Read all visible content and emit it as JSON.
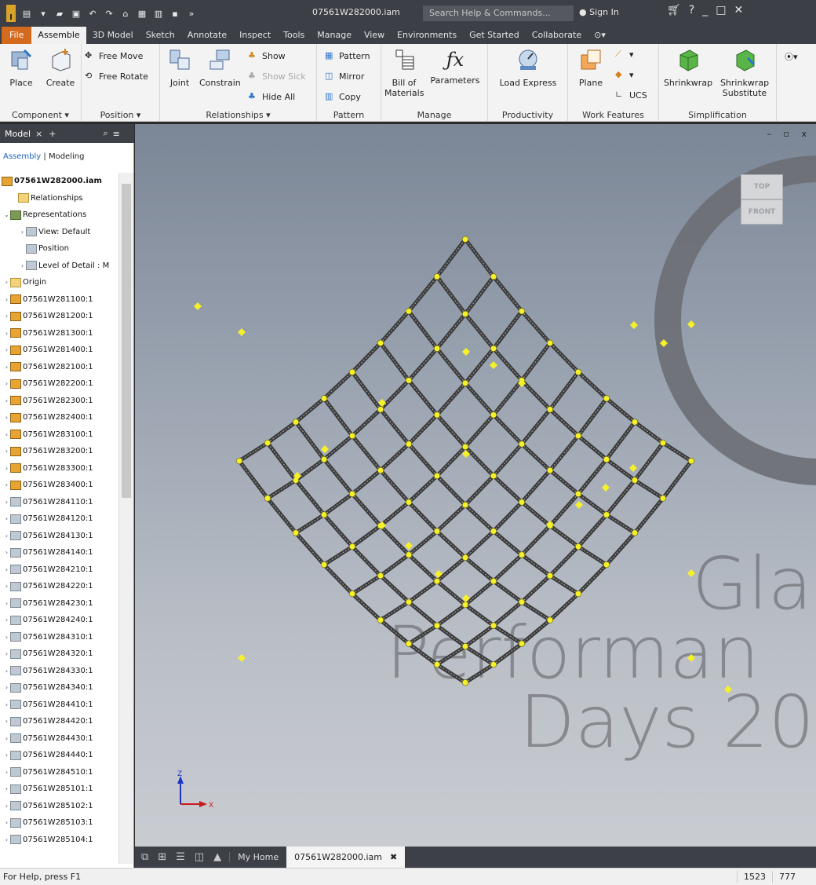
{
  "titlebar": {
    "app_logo": "I",
    "doc_title": "07561W282000.iam",
    "search_placeholder": "Search Help & Commands...",
    "sign_in": "Sign In",
    "qat_icons": [
      "new-icon",
      "open-icon",
      "save-icon",
      "undo-icon",
      "redo-icon",
      "home-icon",
      "appearance-icon",
      "material-icon",
      "measure-icon",
      "more-icon"
    ],
    "controls": [
      "cart-icon",
      "help-icon",
      "minimize-icon",
      "maximize-icon",
      "close-icon"
    ]
  },
  "menu_tabs": [
    "File",
    "Assemble",
    "3D Model",
    "Sketch",
    "Annotate",
    "Inspect",
    "Tools",
    "Manage",
    "View",
    "Environments",
    "Get Started",
    "Collaborate"
  ],
  "menu_active": "Assemble",
  "ribbon": {
    "component": {
      "title": "Component ▾",
      "place": "Place",
      "create": "Create"
    },
    "position": {
      "title": "Position ▾",
      "free_move": "Free Move",
      "free_rotate": "Free Rotate"
    },
    "relationships": {
      "title": "Relationships ▾",
      "joint": "Joint",
      "constrain": "Constrain",
      "show": "Show",
      "show_sick": "Show Sick",
      "hide_all": "Hide All"
    },
    "pattern": {
      "title": "Pattern",
      "pattern": "Pattern",
      "mirror": "Mirror",
      "copy": "Copy"
    },
    "manage": {
      "title": "Manage",
      "bom_line1": "Bill of",
      "bom_line2": "Materials",
      "parameters": "Parameters"
    },
    "productivity": {
      "title": "Productivity",
      "load_express": "Load Express"
    },
    "work_features": {
      "title": "Work Features",
      "plane": "Plane",
      "ucs": "UCS"
    },
    "simplification": {
      "title": "Simplification",
      "shrinkwrap": "Shrinkwrap",
      "shrinkwrap_sub1": "Shrinkwrap",
      "shrinkwrap_sub2": "Substitute"
    }
  },
  "browser": {
    "tab": "Model",
    "tab_close": "×",
    "tab_add": "+",
    "mode_assembly": "Assembly",
    "mode_sep": "|",
    "mode_modeling": "Modeling",
    "root": "07561W282000.iam",
    "nodes": [
      {
        "label": "Relationships",
        "icon": "folder",
        "indent": 1,
        "exp": ""
      },
      {
        "label": "Representations",
        "icon": "rep",
        "indent": 0,
        "exp": "v"
      },
      {
        "label": "View: Default",
        "icon": "part2",
        "indent": 2,
        "exp": ">"
      },
      {
        "label": "Position",
        "icon": "part2",
        "indent": 2,
        "exp": ""
      },
      {
        "label": "Level of Detail : M",
        "icon": "part2",
        "indent": 2,
        "exp": ">"
      },
      {
        "label": "Origin",
        "icon": "folder",
        "indent": 0,
        "exp": ">"
      },
      {
        "label": "07561W281100:1",
        "icon": "asm",
        "indent": 0,
        "exp": ">"
      },
      {
        "label": "07561W281200:1",
        "icon": "asm",
        "indent": 0,
        "exp": ">"
      },
      {
        "label": "07561W281300:1",
        "icon": "asm",
        "indent": 0,
        "exp": ">"
      },
      {
        "label": "07561W281400:1",
        "icon": "asm",
        "indent": 0,
        "exp": ">"
      },
      {
        "label": "07561W282100:1",
        "icon": "asm",
        "indent": 0,
        "exp": ">"
      },
      {
        "label": "07561W282200:1",
        "icon": "asm",
        "indent": 0,
        "exp": ">"
      },
      {
        "label": "07561W282300:1",
        "icon": "asm",
        "indent": 0,
        "exp": ">"
      },
      {
        "label": "07561W282400:1",
        "icon": "asm",
        "indent": 0,
        "exp": ">"
      },
      {
        "label": "07561W283100:1",
        "icon": "asm",
        "indent": 0,
        "exp": ">"
      },
      {
        "label": "07561W283200:1",
        "icon": "asm",
        "indent": 0,
        "exp": ">"
      },
      {
        "label": "07561W283300:1",
        "icon": "asm",
        "indent": 0,
        "exp": ">"
      },
      {
        "label": "07561W283400:1",
        "icon": "asm",
        "indent": 0,
        "exp": ">"
      },
      {
        "label": "07561W284110:1",
        "icon": "part2",
        "indent": 0,
        "exp": ">"
      },
      {
        "label": "07561W284120:1",
        "icon": "part2",
        "indent": 0,
        "exp": ">"
      },
      {
        "label": "07561W284130:1",
        "icon": "part2",
        "indent": 0,
        "exp": ">"
      },
      {
        "label": "07561W284140:1",
        "icon": "part2",
        "indent": 0,
        "exp": ">"
      },
      {
        "label": "07561W284210:1",
        "icon": "part2",
        "indent": 0,
        "exp": ">"
      },
      {
        "label": "07561W284220:1",
        "icon": "part2",
        "indent": 0,
        "exp": ">"
      },
      {
        "label": "07561W284230:1",
        "icon": "part2",
        "indent": 0,
        "exp": ">"
      },
      {
        "label": "07561W284240:1",
        "icon": "part2",
        "indent": 0,
        "exp": ">"
      },
      {
        "label": "07561W284310:1",
        "icon": "part2",
        "indent": 0,
        "exp": ">"
      },
      {
        "label": "07561W284320:1",
        "icon": "part2",
        "indent": 0,
        "exp": ">"
      },
      {
        "label": "07561W284330:1",
        "icon": "part2",
        "indent": 0,
        "exp": ">"
      },
      {
        "label": "07561W284340:1",
        "icon": "part2",
        "indent": 0,
        "exp": ">"
      },
      {
        "label": "07561W284410:1",
        "icon": "part2",
        "indent": 0,
        "exp": ">"
      },
      {
        "label": "07561W284420:1",
        "icon": "part2",
        "indent": 0,
        "exp": ">"
      },
      {
        "label": "07561W284430:1",
        "icon": "part2",
        "indent": 0,
        "exp": ">"
      },
      {
        "label": "07561W284440:1",
        "icon": "part2",
        "indent": 0,
        "exp": ">"
      },
      {
        "label": "07561W284510:1",
        "icon": "part2",
        "indent": 0,
        "exp": ">"
      },
      {
        "label": "07561W285101:1",
        "icon": "part2",
        "indent": 0,
        "exp": ">"
      },
      {
        "label": "07561W285102:1",
        "icon": "part2",
        "indent": 0,
        "exp": ">"
      },
      {
        "label": "07561W285103:1",
        "icon": "part2",
        "indent": 0,
        "exp": ">"
      },
      {
        "label": "07561W285104:1",
        "icon": "part2",
        "indent": 0,
        "exp": ">"
      }
    ]
  },
  "viewport": {
    "viewcube_top": "TOP",
    "viewcube_front": "FRONT",
    "controls": "– ▫ x",
    "watermark": [
      "Gla",
      "Performan",
      "Days 20"
    ],
    "triad_z": "Z",
    "triad_x": "X"
  },
  "doc_tabs": {
    "home": "My Home",
    "active": "07561W282000.iam",
    "close": "✖"
  },
  "status": {
    "help": "For Help, press F1",
    "count1": "1523",
    "count2": "777"
  },
  "colors": {
    "accent_file": "#d46a1e",
    "dark_ui": "#3c3f45",
    "point_yellow": "#f5f02a"
  }
}
